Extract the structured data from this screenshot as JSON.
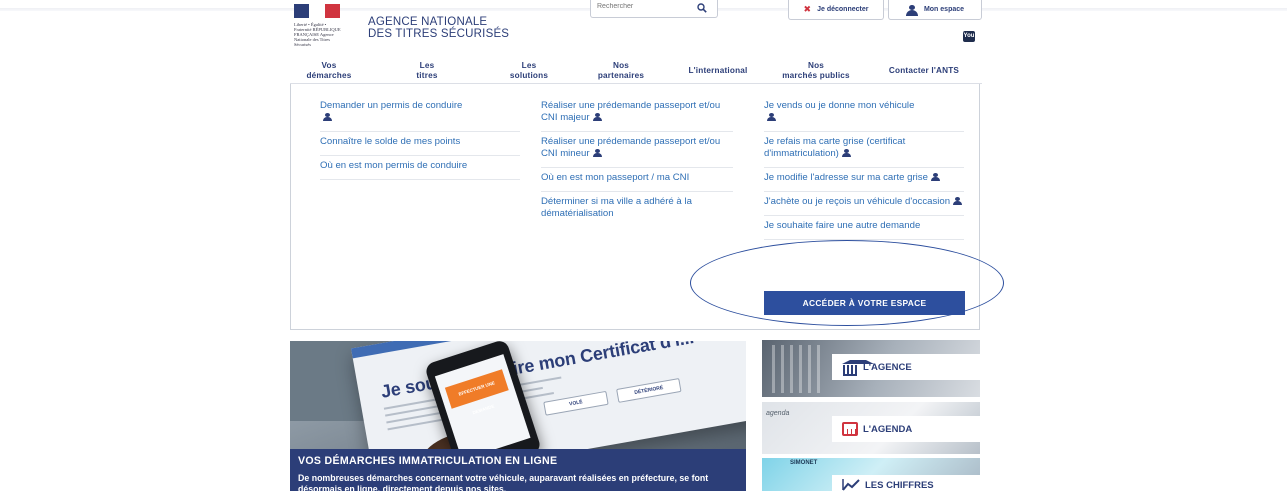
{
  "header": {
    "logo_text": "Liberté • Égalité • Fraternité RÉPUBLIQUE FRANÇAISE Agence Nationale des Titres Sécurisés",
    "agency_line1": "AGENCE NATIONALE",
    "agency_line2": "DES TITRES SÉCURISÉS",
    "search_placeholder": "Rechercher",
    "logout_label": "Je déconnecter",
    "my_space_label": "Mon espace",
    "youtube_label": "You"
  },
  "nav": {
    "items": [
      {
        "label": "Vos\ndémarches"
      },
      {
        "label": "Les\ntitres"
      },
      {
        "label": "Les\nsolutions"
      },
      {
        "label": "Nos\npartenaires"
      },
      {
        "label": "L'international"
      },
      {
        "label": "Nos\nmarchés publics"
      },
      {
        "label": "Contacter l'ANTS"
      }
    ]
  },
  "panel": {
    "col1": [
      {
        "label": "Demander un permis de conduire",
        "account": true
      },
      {
        "label": "Connaître le solde de mes points",
        "account": false
      },
      {
        "label": "Où en est mon permis de conduire",
        "account": false
      }
    ],
    "col2": [
      {
        "label": "Réaliser une prédemande passeport et/ou CNI majeur",
        "account": true
      },
      {
        "label": "Réaliser une prédemande passeport et/ou CNI mineur",
        "account": true
      },
      {
        "label": "Où en est mon passeport / ma CNI",
        "account": false
      },
      {
        "label": "Déterminer si ma ville a adhéré à la dématérialisation",
        "account": false
      }
    ],
    "col3": [
      {
        "label": "Je vends ou je donne mon véhicule",
        "account": true
      },
      {
        "label": "Je refais ma carte grise (certificat d'immatriculation)",
        "account": true
      },
      {
        "label": "Je modifie l'adresse sur ma carte grise",
        "account": true
      },
      {
        "label": "J'achète ou je reçois un véhicule d'occasion",
        "account": true
      },
      {
        "label": "Je souhaite faire une autre demande",
        "account": false
      }
    ],
    "cta_label": "ACCÉDER À VOTRE ESPACE"
  },
  "hero": {
    "screen_headline": "Je souhaite refaire mon Certificat d'i...",
    "screen_btn1": "VOLÉ",
    "screen_btn2": "DÉTÉRIORÉ",
    "phone_button": "EFFECTUER UNE DEMANDE",
    "title": "VOS DÉMARCHES IMMATRICULATION EN LIGNE",
    "text": "De nombreuses démarches concernant votre véhicule, auparavant réalisées en préfecture, se font désormais en ligne, directement depuis nos sites."
  },
  "sidebar": {
    "agence_label": "L'AGENCE",
    "agenda_label": "L'AGENDA",
    "chiffres_label": "LES CHIFFRES",
    "agenda_deco": "agenda",
    "chiffres_deco": "SIMONET"
  },
  "colors": {
    "brand_navy": "#2c3e78",
    "link_blue": "#2f6fb5",
    "cta_blue": "#2d4f9e",
    "logout_red": "#d0343f"
  }
}
